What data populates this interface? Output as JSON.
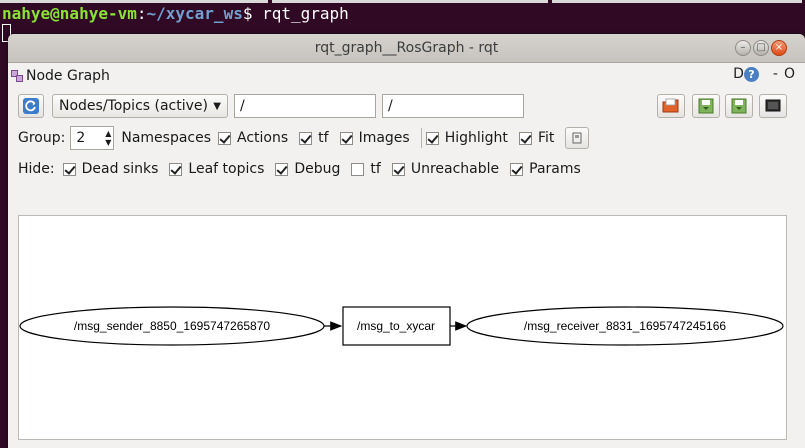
{
  "terminal": {
    "user_host": "nahye@nahye-vm",
    "path": "~/xycar_ws",
    "prompt_suffix": "$ ",
    "command": "rqt_graph"
  },
  "window": {
    "title": "rqt_graph__RosGraph - rqt"
  },
  "plugin": {
    "title": "Node Graph",
    "right_d": "D",
    "help": "?",
    "dash": "-",
    "close": "O"
  },
  "toolbar": {
    "mode": "Nodes/Topics (active)",
    "node_filter": "/",
    "topic_filter": "/"
  },
  "group_row": {
    "group_label": "Group:",
    "group_value": "2",
    "namespaces_label": "Namespaces",
    "actions_label": "Actions",
    "tf_label": "tf",
    "images_label": "Images",
    "highlight_label": "Highlight",
    "fit_label": "Fit",
    "namespaces_checked": true,
    "actions_checked": true,
    "tf_checked": true,
    "images_checked": true,
    "highlight_checked": true,
    "fit_checked": true
  },
  "hide_row": {
    "hide_label": "Hide:",
    "dead_sinks_label": "Dead sinks",
    "leaf_topics_label": "Leaf topics",
    "debug_label": "Debug",
    "tf_label": "tf",
    "unreachable_label": "Unreachable",
    "params_label": "Params",
    "dead_sinks_checked": true,
    "leaf_topics_checked": true,
    "debug_checked": true,
    "tf_checked": false,
    "unreachable_checked": true,
    "params_checked": true
  },
  "graph": {
    "sender_node": "/msg_sender_8850_1695747265870",
    "topic": "/msg_to_xycar",
    "receiver_node": "/msg_receiver_8831_1695747245166"
  }
}
